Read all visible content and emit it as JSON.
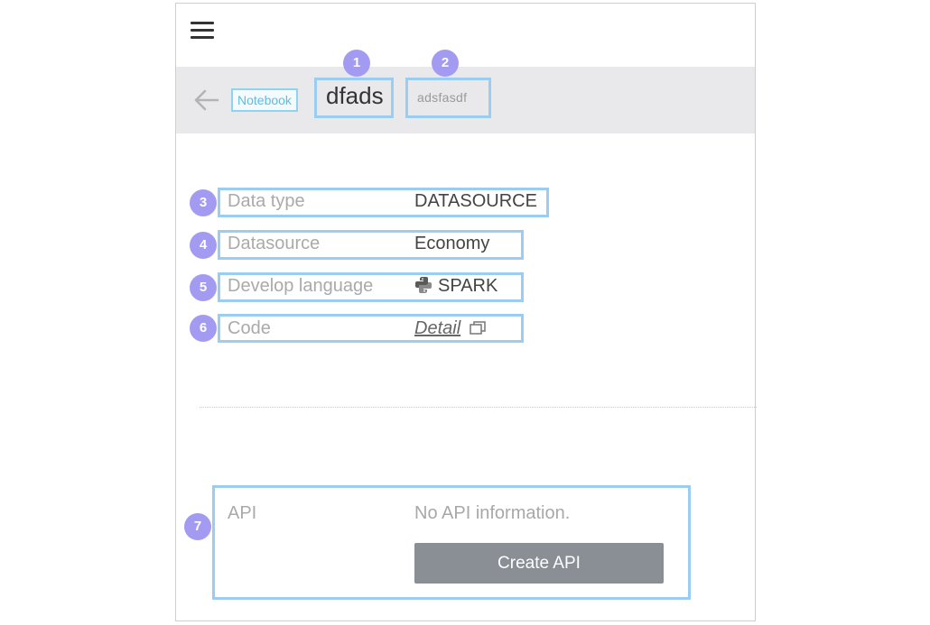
{
  "header": {
    "tag": "Notebook",
    "title": "dfads",
    "subtitle": "adsfasdf"
  },
  "menu_icon": "hamburger-menu-icon",
  "back_icon": "arrow-left-icon",
  "annotations": [
    "1",
    "2",
    "3",
    "4",
    "5",
    "6",
    "7"
  ],
  "details": {
    "data_type": {
      "label": "Data type",
      "value": "DATASOURCE"
    },
    "datasource": {
      "label": "Datasource",
      "value": "Economy"
    },
    "language": {
      "label": "Develop language",
      "value": "SPARK",
      "icon": "python-icon"
    },
    "code": {
      "label": "Code",
      "link": "Detail",
      "icon": "open-window-icon"
    }
  },
  "api": {
    "label": "API",
    "message": "No API information.",
    "button": "Create API"
  },
  "colors": {
    "highlight": "#9bcdf3",
    "badge": "#a39bf1",
    "tag_border": "#8fd3ee",
    "button_bg": "#8a8f96",
    "header_bg": "#e9e9eb"
  }
}
